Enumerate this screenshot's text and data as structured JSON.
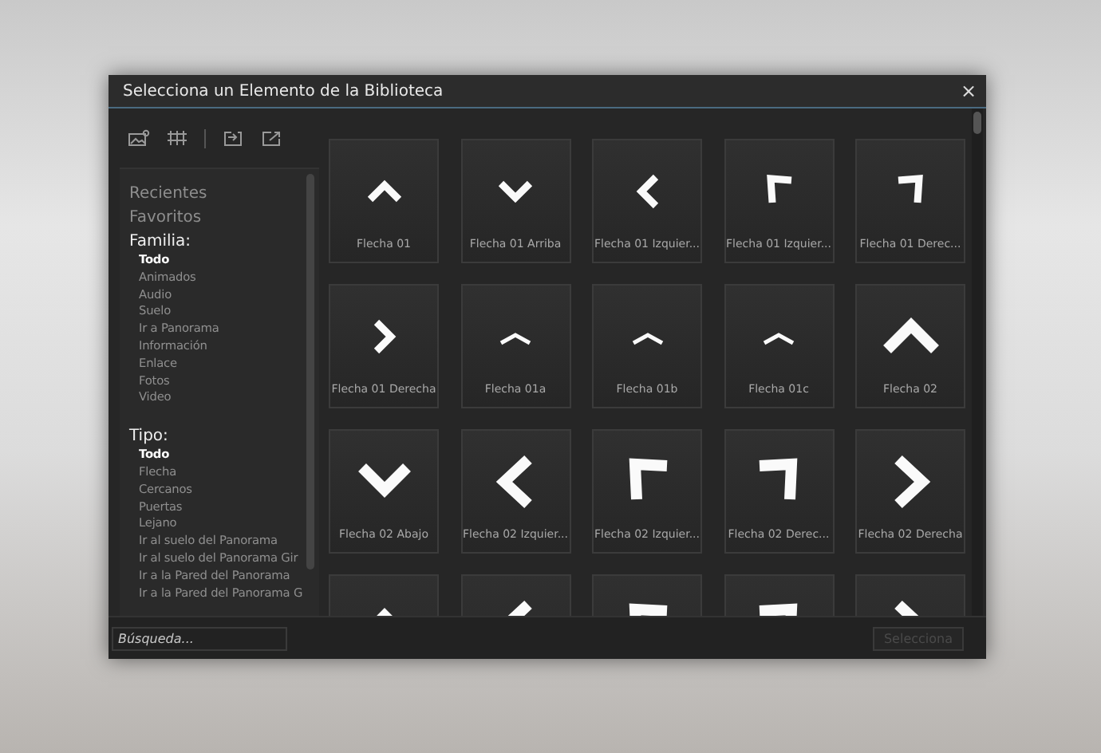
{
  "window": {
    "title": "Selecciona un Elemento de la Biblioteca",
    "close": "×"
  },
  "sidebar": {
    "links": [
      "Recientes",
      "Favoritos"
    ],
    "groups": [
      {
        "heading": "Familia:",
        "items": [
          {
            "label": "Todo",
            "selected": true
          },
          {
            "label": "Animados",
            "selected": false
          },
          {
            "label": "Audio",
            "selected": false
          },
          {
            "label": "Suelo",
            "selected": false
          },
          {
            "label": "Ir a Panorama",
            "selected": false
          },
          {
            "label": "Información",
            "selected": false
          },
          {
            "label": "Enlace",
            "selected": false
          },
          {
            "label": "Fotos",
            "selected": false
          },
          {
            "label": "Video",
            "selected": false
          }
        ]
      },
      {
        "heading": "Tipo:",
        "items": [
          {
            "label": "Todo",
            "selected": true
          },
          {
            "label": "Flecha",
            "selected": false
          },
          {
            "label": "Cercanos",
            "selected": false
          },
          {
            "label": "Puertas",
            "selected": false
          },
          {
            "label": "Lejano",
            "selected": false
          },
          {
            "label": "Ir al suelo del Panorama",
            "selected": false
          },
          {
            "label": "Ir al suelo del Panorama Gir",
            "selected": false
          },
          {
            "label": "Ir a la Pared del Panorama",
            "selected": false
          },
          {
            "label": "Ir a la Pared del Panorama G",
            "selected": false
          }
        ]
      }
    ]
  },
  "library": {
    "items": [
      {
        "label": "Flecha 01",
        "kind": "up",
        "heavy": false
      },
      {
        "label": "Flecha 01 Arriba",
        "kind": "down",
        "heavy": false
      },
      {
        "label": "Flecha 01 Izquier...",
        "kind": "left",
        "heavy": false
      },
      {
        "label": "Flecha 01 Izquier...",
        "kind": "cornerleft",
        "heavy": false
      },
      {
        "label": "Flecha 01 Derec...",
        "kind": "cornerright",
        "heavy": false
      },
      {
        "label": "Flecha 01 Derecha",
        "kind": "right",
        "heavy": false
      },
      {
        "label": "Flecha 01a",
        "kind": "flatup",
        "heavy": false
      },
      {
        "label": "Flecha 01b",
        "kind": "flatup",
        "heavy": false
      },
      {
        "label": "Flecha 01c",
        "kind": "flatup",
        "heavy": false
      },
      {
        "label": "Flecha 02",
        "kind": "up",
        "heavy": true
      },
      {
        "label": "Flecha 02 Abajo",
        "kind": "down",
        "heavy": true
      },
      {
        "label": "Flecha 02 Izquier...",
        "kind": "left",
        "heavy": true
      },
      {
        "label": "Flecha 02 Izquier...",
        "kind": "cornerleft",
        "heavy": true
      },
      {
        "label": "Flecha 02 Derec...",
        "kind": "cornerright",
        "heavy": true
      },
      {
        "label": "Flecha 02 Derecha",
        "kind": "right",
        "heavy": true
      },
      {
        "kind": "up",
        "heavy": true
      },
      {
        "kind": "left",
        "heavy": true
      },
      {
        "kind": "cornerleft",
        "heavy": true
      },
      {
        "kind": "cornerright",
        "heavy": true
      },
      {
        "kind": "right",
        "heavy": true
      }
    ]
  },
  "search": {
    "placeholder": "Búsqueda..."
  },
  "buttons": [
    {
      "label": "Selecciona",
      "disabled": true
    }
  ]
}
